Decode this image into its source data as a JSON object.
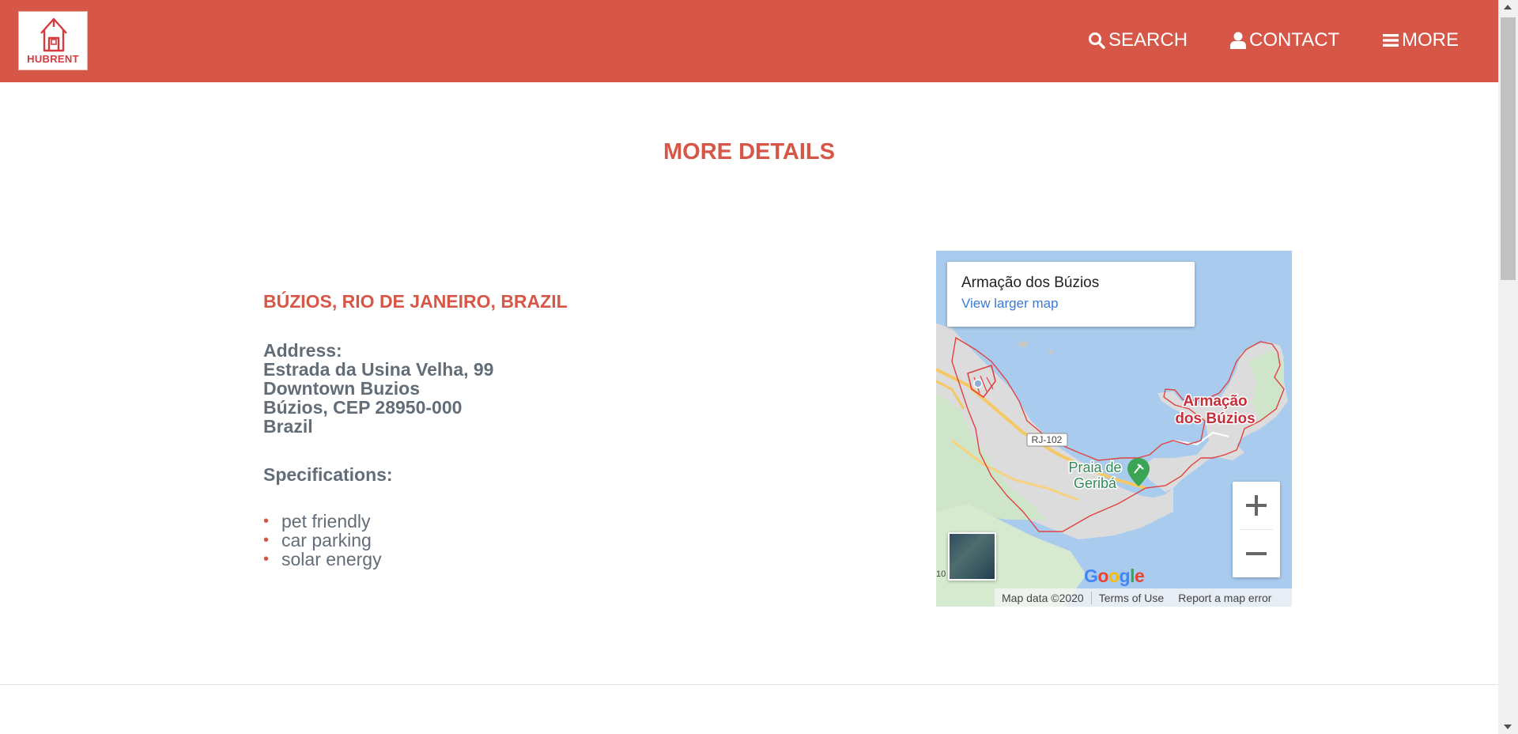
{
  "brand": {
    "name": "HUBRENT",
    "color": "#d65647"
  },
  "nav": {
    "search_label": "SEARCH",
    "contact_label": "CONTACT",
    "more_label": "MORE"
  },
  "main": {
    "title": "MORE DETAILS",
    "location": "BÚZIOS, RIO DE JANEIRO, BRAZIL",
    "address_label": "Address:",
    "address_lines": [
      "Estrada da Usina Velha, 99",
      "Downtown Buzios",
      "Búzios, CEP 28950-000",
      "Brazil"
    ],
    "specifications_label": "Specifications:",
    "specifications": [
      "pet friendly",
      "car parking",
      "solar energy"
    ]
  },
  "map": {
    "place_name": "Armação dos Búzios",
    "larger_map_label": "View larger map",
    "city_label_line1": "Armação",
    "city_label_line2": "dos Búzios",
    "beach_label_line1": "Praia de",
    "beach_label_line2": "Geribá",
    "road_label": "RJ-102",
    "edge_label": "10",
    "google": "Google",
    "map_data": "Map data ©2020",
    "terms": "Terms of Use",
    "report": "Report a map error"
  }
}
